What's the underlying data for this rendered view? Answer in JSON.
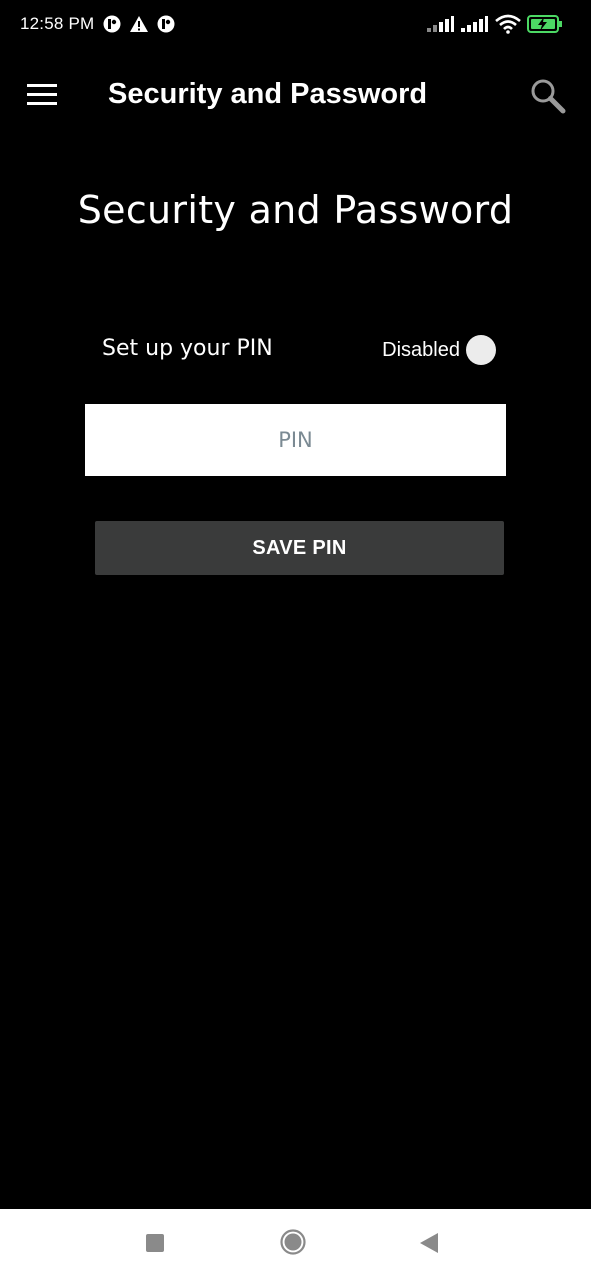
{
  "status_bar": {
    "time": "12:58 PM",
    "left_icons": [
      "notification-app-icon",
      "warning-icon",
      "notification-app-icon"
    ],
    "right_icons": [
      "cell-signal-icon",
      "cell-signal-icon",
      "wifi-icon",
      "battery-charging-icon"
    ]
  },
  "app_bar": {
    "title": "Security and Password",
    "menu_icon": "hamburger-menu-icon",
    "search_icon": "search-icon"
  },
  "main": {
    "title": "Security and Password",
    "pin_row": {
      "label": "Set up your PIN",
      "toggle_text": "Disabled",
      "toggle_state": "off"
    },
    "pin_input": {
      "placeholder": "PIN",
      "value": ""
    },
    "save_button": {
      "label": "SAVE PIN"
    }
  },
  "nav_bar": {
    "recent_icon": "recent-apps-icon",
    "home_icon": "home-icon",
    "back_icon": "back-icon"
  },
  "colors": {
    "background": "#000000",
    "button": "#3a3b3b",
    "placeholder": "#7b8a93",
    "battery": "#4cd964"
  }
}
